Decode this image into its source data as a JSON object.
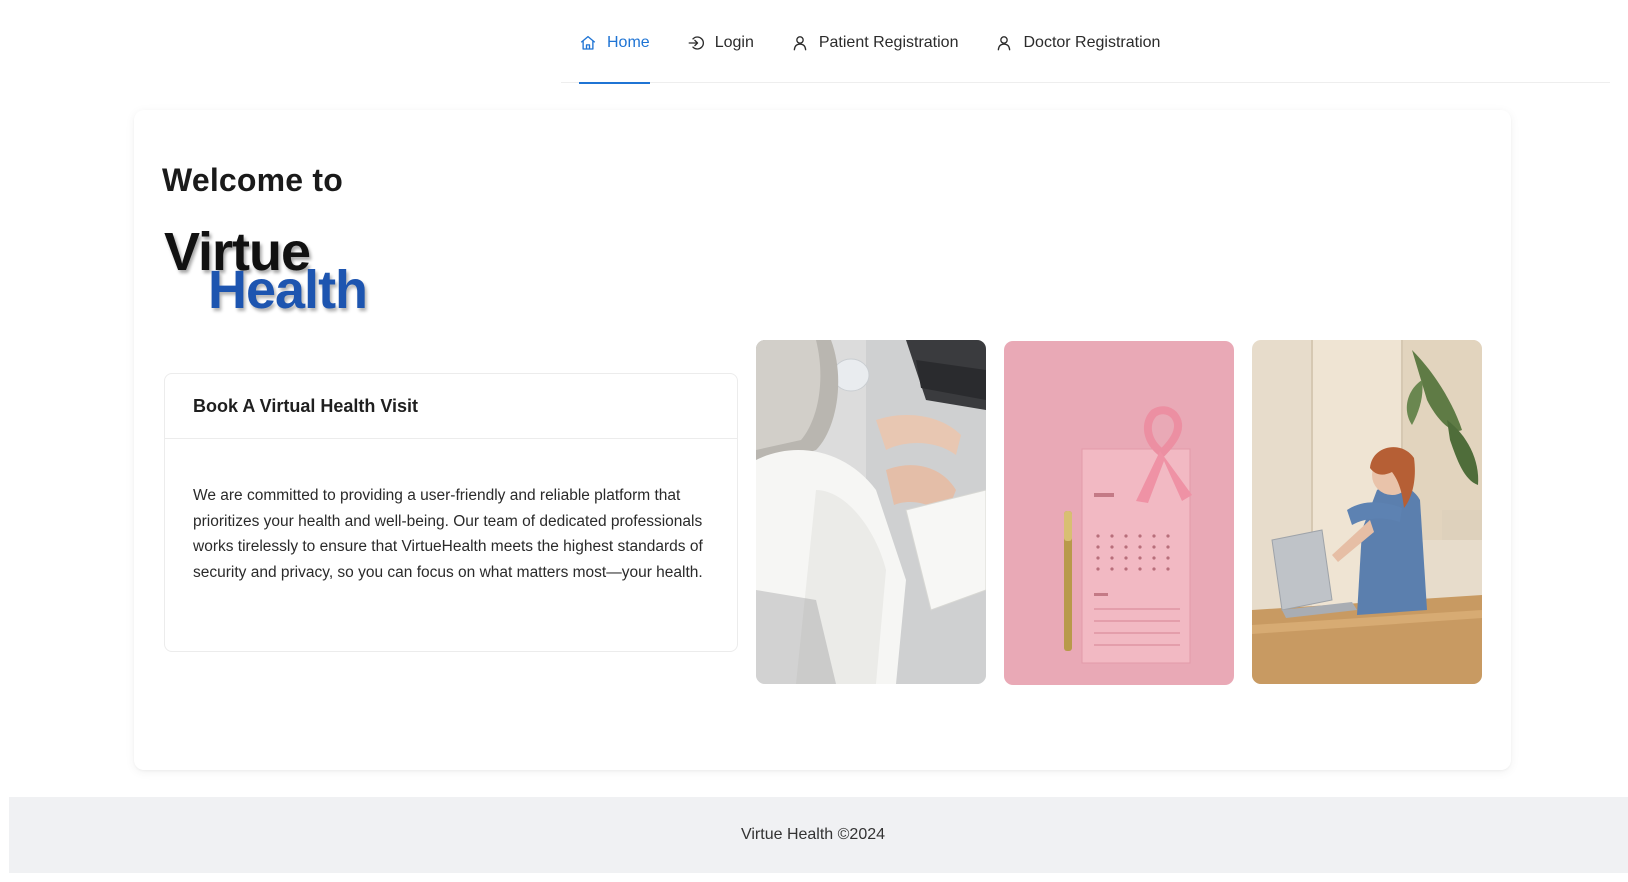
{
  "nav": {
    "items": [
      {
        "label": "Home",
        "icon": "home-icon",
        "active": true
      },
      {
        "label": "Login",
        "icon": "login-icon",
        "active": false
      },
      {
        "label": "Patient Registration",
        "icon": "user-icon",
        "active": false
      },
      {
        "label": "Doctor Registration",
        "icon": "user-icon",
        "active": false
      }
    ],
    "active_color": "#1f74d4"
  },
  "hero": {
    "welcome": "Welcome to",
    "logo": {
      "line1": "Virtue",
      "line2": "Health",
      "color1": "#111111",
      "color2": "#1d55b0"
    }
  },
  "info_card": {
    "title": "Book A Virtual Health Visit",
    "body": "We are committed to providing a user-friendly and reliable platform that prioritizes your health and well-being. Our team of dedicated professionals works tirelessly to ensure that VirtueHealth meets the highest standards of security and privacy, so you can focus on what matters most—your health."
  },
  "images": [
    {
      "name": "elderly-woman-laptop-image"
    },
    {
      "name": "pink-ribbon-calendar-image"
    },
    {
      "name": "woman-coughing-laptop-image"
    }
  ],
  "footer": {
    "text": "Virtue Health ©2024",
    "background": "#f0f1f3"
  }
}
